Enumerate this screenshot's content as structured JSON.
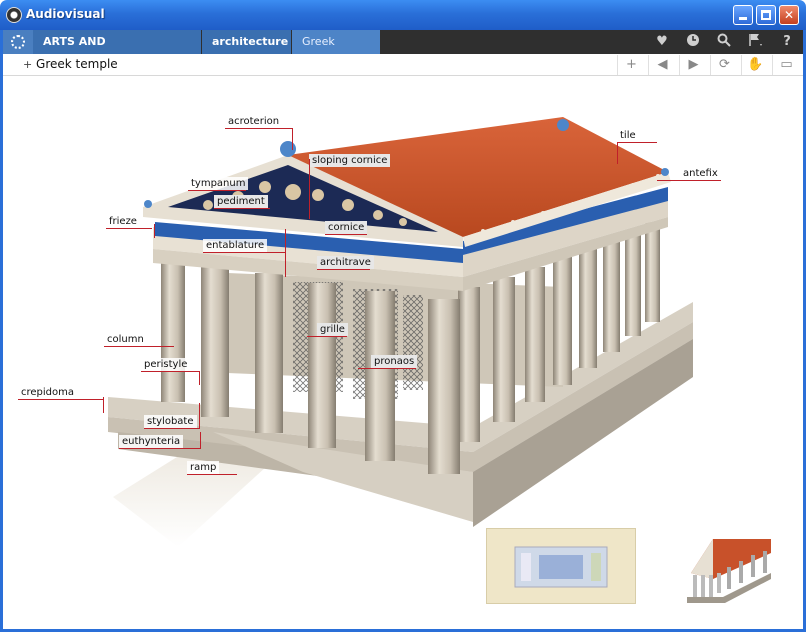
{
  "window": {
    "title": "Audiovisual"
  },
  "nav": {
    "breadcrumbs": [
      "ARTS AND ARCHITECTURE",
      "architecture",
      "Greek temple"
    ],
    "icons": [
      "heart-icon",
      "clock-icon",
      "search-icon",
      "flag-icon",
      "help-icon"
    ],
    "help_label": "?"
  },
  "toolbar": {
    "title": "Greek temple",
    "plus": "+"
  },
  "colors": {
    "title_blue": "#2a6fd8",
    "nav_dark": "#2f2f2f",
    "crumb_blue": "#3a6fb0",
    "roof_tile": "#c8512a",
    "frieze_blue": "#2a5fb0",
    "leader_red": "#c0202a"
  },
  "diagram": {
    "labels": {
      "acroterion": "acroterion",
      "tile": "tile",
      "sloping_cornice": "sloping cornice",
      "antefix": "antefix",
      "tympanum": "tympanum",
      "pediment": "pediment",
      "frieze": "frieze",
      "cornice": "cornice",
      "entablature": "entablature",
      "architrave": "architrave",
      "column": "column",
      "grille": "grille",
      "pronaos": "pronaos",
      "peristyle": "peristyle",
      "crepidoma": "crepidoma",
      "stylobate": "stylobate",
      "euthynteria": "euthynteria",
      "ramp": "ramp"
    }
  }
}
